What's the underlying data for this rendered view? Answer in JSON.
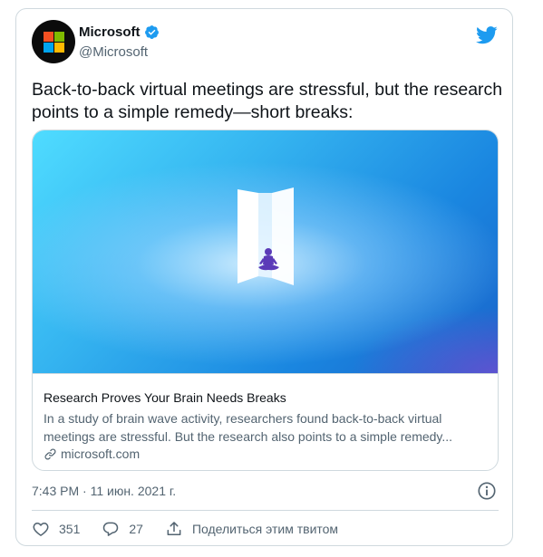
{
  "tweet": {
    "author_name": "Microsoft",
    "author_handle": "@Microsoft",
    "text": "Back-to-back virtual meetings are stressful, but the research points to a simple remedy—short breaks:",
    "timestamp": "7:43 PM · 11 июн. 2021 г.",
    "likes": "351",
    "replies": "27",
    "share_label": "Поделиться этим твитом"
  },
  "card": {
    "title": "Research Proves Your Brain Needs Breaks",
    "description": "In a study of brain wave activity, researchers found back-to-back virtual meetings are stressful. But the research also points to a simple remedy...",
    "domain": "microsoft.com"
  },
  "colors": {
    "twitter_blue": "#1d9bf0",
    "verified_blue": "#1d9bf0",
    "ms_red": "#f25022",
    "ms_green": "#7fba00",
    "ms_blue": "#00a4ef",
    "ms_yellow": "#ffb900",
    "secondary_text": "#536471"
  },
  "icons": [
    "microsoft-logo-icon",
    "verified-badge-icon",
    "twitter-bird-icon",
    "link-icon",
    "info-icon",
    "heart-icon",
    "reply-icon",
    "share-icon"
  ]
}
